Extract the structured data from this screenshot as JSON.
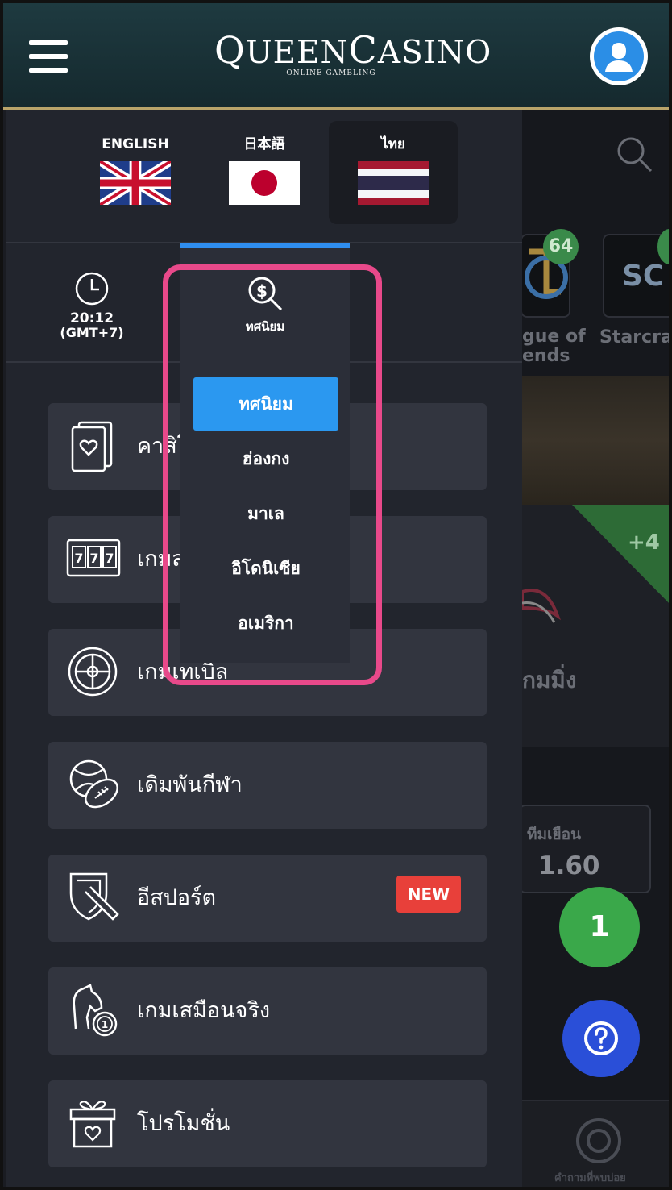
{
  "header": {
    "logo_main_q": "Q",
    "logo_main_ueen": "UEEN",
    "logo_main_c": "C",
    "logo_main_asino": "ASINO",
    "logo_sub": "ONLINE GAMBLING",
    "menu_icon": "hamburger-icon",
    "account_icon": "user-avatar-icon",
    "colors": {
      "header_bg": "#1e3a40",
      "gold_rule": "#b9a46a",
      "avatar_blue": "#2b8ee6"
    }
  },
  "languages": [
    {
      "label": "ENGLISH",
      "flag": "uk-flag-icon",
      "active": false
    },
    {
      "label": "日本語",
      "flag": "japan-flag-icon",
      "active": false
    },
    {
      "label": "ไทย",
      "flag": "thailand-flag-icon",
      "active": true
    }
  ],
  "tools": {
    "clock_icon": "clock-icon",
    "time": "20:12",
    "timezone": "(GMT+7)",
    "odds_icon": "odds-search-icon",
    "odds_label": "ทศนิยม"
  },
  "odds_dropdown": {
    "options": [
      "ทศนิยม",
      "ฮ่องกง",
      "มาเล",
      "อิโดนิเซีย",
      "อเมริกา"
    ],
    "selected": "ทศนิยม",
    "colors": {
      "selected_bg": "#2b98f0",
      "highlight_border": "#e8498a"
    }
  },
  "menu_items": [
    {
      "label": "คาสิโน",
      "icon": "cards-icon",
      "badge": ""
    },
    {
      "label": "เกมสล็อต",
      "icon": "slot-machine-icon",
      "badge": ""
    },
    {
      "label": "เกมเทเบิล",
      "icon": "roulette-icon",
      "badge": ""
    },
    {
      "label": "เดิมพันกีฬา",
      "icon": "sports-balls-icon",
      "badge": ""
    },
    {
      "label": "อีสปอร์ต",
      "icon": "esports-shield-icon",
      "badge": "NEW"
    },
    {
      "label": "เกมเสมือนจริง",
      "icon": "horse-racing-icon",
      "badge": ""
    },
    {
      "label": "โปรโมชั่น",
      "icon": "gift-icon",
      "badge": ""
    }
  ],
  "background": {
    "search_icon": "search-icon",
    "badge_64": "64",
    "tile1_text_line1": "gue of",
    "tile1_text_line2": "ends",
    "tile2_text": "Starcraft",
    "plus_badge": "+4",
    "game_text": "กมมิ่ง",
    "odds_label": "ทีมเยือน",
    "odds_value": "1.60",
    "bottom_label": "คำถามที่พบบ่อย",
    "chat_count": "1",
    "help_icon": "help-question-icon"
  }
}
